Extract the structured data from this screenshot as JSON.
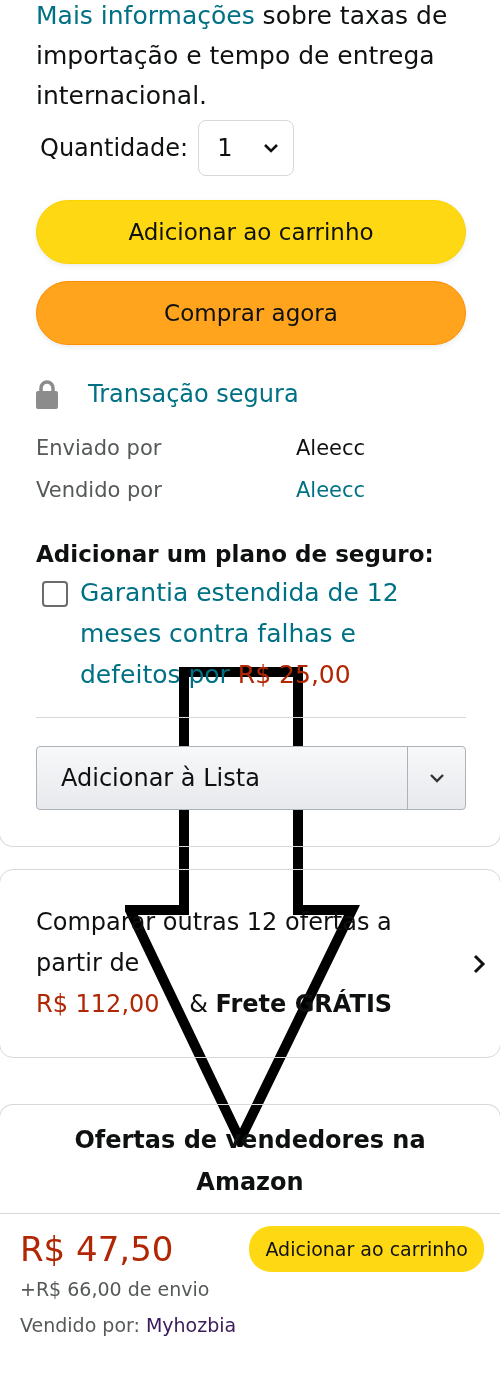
{
  "import_info": {
    "link": "Mais informações",
    "text": "sobre taxas de importação e tempo de entrega internacional."
  },
  "quantity": {
    "label": "Quantidade:",
    "value": "1"
  },
  "buttons": [
    {
      "label": "Adicionar ao carrinho",
      "kind": "cart"
    },
    {
      "label": "Comprar agora",
      "kind": "buy"
    }
  ],
  "secure": "Transação segura",
  "seller_info": [
    {
      "label": "Enviado por",
      "value": "Aleecc",
      "link": false
    },
    {
      "label": "Vendido por",
      "value": "Aleecc",
      "link": true
    }
  ],
  "insurance": {
    "heading": "Adicionar um plano de seguro:",
    "checked": false,
    "text": "Garantia estendida de 12 meses contra falhas e defeitos por",
    "price": "R$ 25,00"
  },
  "list_button": "Adicionar à Lista",
  "compare": {
    "text": "Comparar outras 12 ofertas a partir de",
    "price": "R$ 112,00",
    "shipping": "& **Frete GRÁTIS**"
  },
  "offers": {
    "heading": "Ofertas de vendedores na Amazon",
    "price": "R$ 47,50",
    "button": "Adicionar ao carrinho",
    "shipping": "+R$ 66,00 de envio",
    "sold_by_label": "Vendido por:",
    "seller": "Myhozbia"
  }
}
